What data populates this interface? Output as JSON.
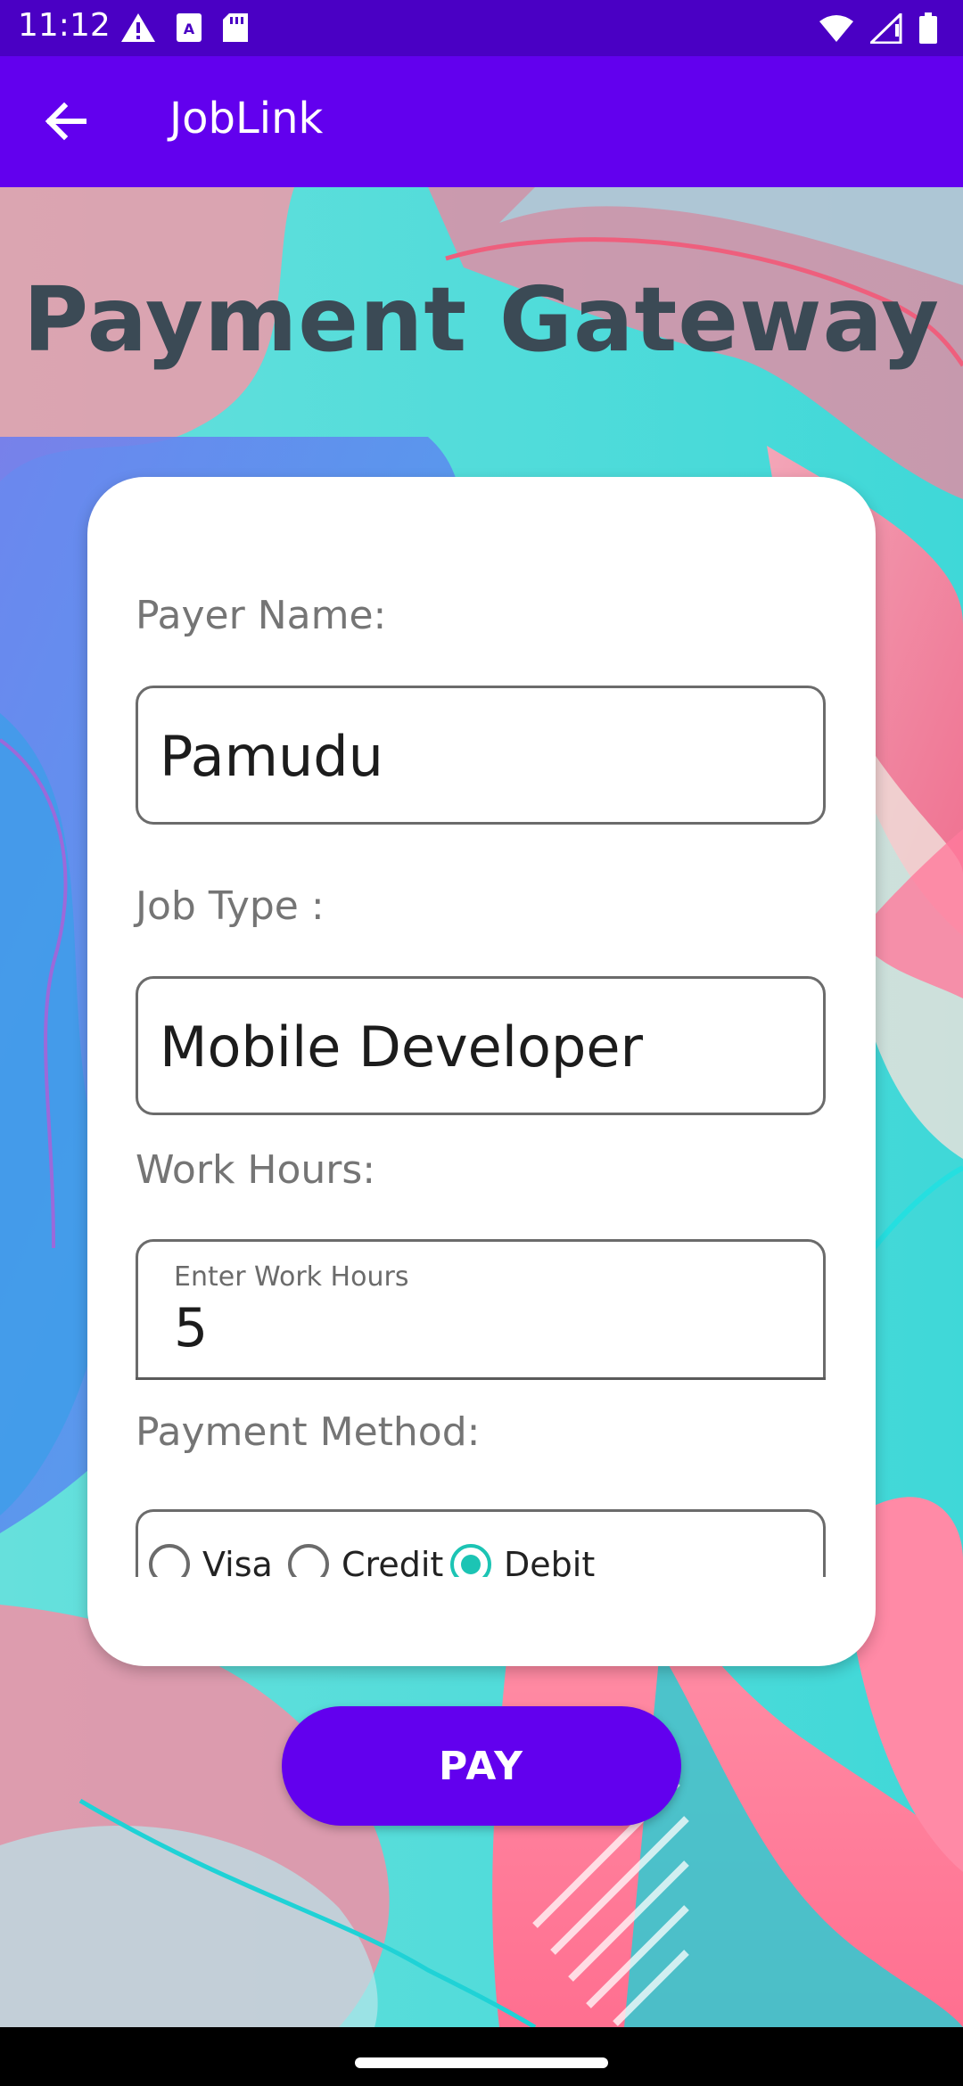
{
  "status_bar": {
    "time": "11:12",
    "left_icons": [
      "alert-icon",
      "sim-icon",
      "sd-card-icon"
    ],
    "right_icons": [
      "wifi-icon",
      "signal-icon",
      "battery-icon"
    ]
  },
  "app_bar": {
    "title": "JobLink",
    "back_icon": "arrow-left-icon"
  },
  "page": {
    "title": "Payment Gateway"
  },
  "form": {
    "payer_name": {
      "label": "Payer Name:",
      "value": "Pamudu"
    },
    "job_type": {
      "label": "Job Type :",
      "value": "Mobile Developer"
    },
    "work_hours": {
      "label": "Work Hours:",
      "hint": "Enter Work Hours",
      "value": "5"
    },
    "payment_method": {
      "label": "Payment Method:",
      "options": [
        {
          "label": "Visa",
          "checked": false
        },
        {
          "label": "Credit",
          "checked": false
        },
        {
          "label": "Debit",
          "checked": true
        }
      ]
    }
  },
  "pay_button": {
    "label": "PAY"
  },
  "colors": {
    "status_bar": "#4a00c4",
    "app_bar": "#6200ee",
    "button": "#6200ee",
    "radio_accent": "#1cc4b4",
    "title": "#3b4a55"
  }
}
